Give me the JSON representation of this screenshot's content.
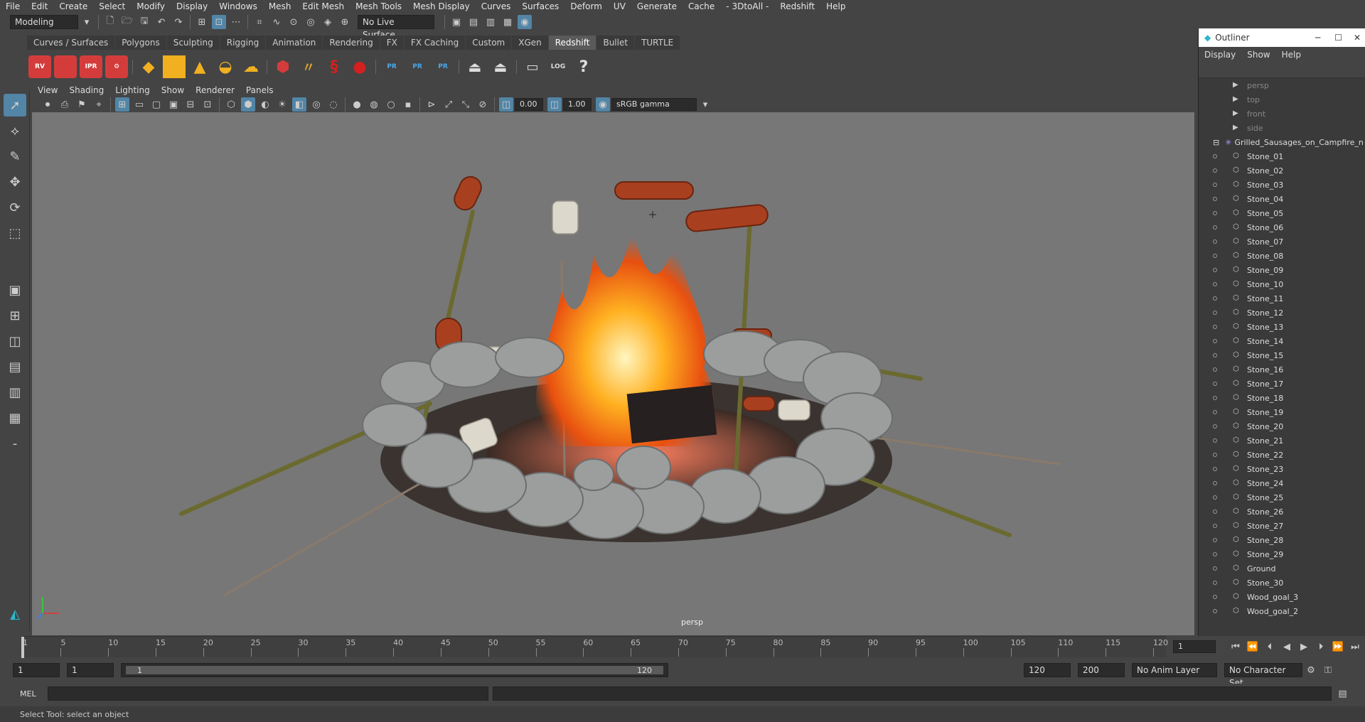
{
  "menubar": {
    "items": [
      "File",
      "Edit",
      "Create",
      "Select",
      "Modify",
      "Display",
      "Windows",
      "Mesh",
      "Edit Mesh",
      "Mesh Tools",
      "Mesh Display",
      "Curves",
      "Surfaces",
      "Deform",
      "UV",
      "Generate",
      "Cache",
      "- 3DtoAll -",
      "Redshift",
      "Help"
    ]
  },
  "statusline": {
    "mode": "Modeling",
    "live_surface": "No Live Surface"
  },
  "shelf": {
    "tabs": [
      "Curves / Surfaces",
      "Polygons",
      "Sculpting",
      "Rigging",
      "Animation",
      "Rendering",
      "FX",
      "FX Caching",
      "Custom",
      "XGen",
      "Redshift",
      "Bullet",
      "TURTLE"
    ],
    "active": "Redshift",
    "icon_labels": [
      "RV",
      "",
      "IPR",
      "",
      "PR",
      "PR",
      "PR",
      "LOG"
    ]
  },
  "panel": {
    "menu": [
      "View",
      "Shading",
      "Lighting",
      "Show",
      "Renderer",
      "Panels"
    ],
    "exposure": "0.00",
    "gamma": "1.00",
    "colorspace": "sRGB gamma",
    "camera_label": "persp"
  },
  "outliner": {
    "title": "Outliner",
    "menu": [
      "Display",
      "Show",
      "Help"
    ],
    "cameras": [
      "persp",
      "top",
      "front",
      "side"
    ],
    "group": "Grilled_Sausages_on_Campfire_n",
    "children": [
      "Stone_01",
      "Stone_02",
      "Stone_03",
      "Stone_04",
      "Stone_05",
      "Stone_06",
      "Stone_07",
      "Stone_08",
      "Stone_09",
      "Stone_10",
      "Stone_11",
      "Stone_12",
      "Stone_13",
      "Stone_14",
      "Stone_15",
      "Stone_16",
      "Stone_17",
      "Stone_18",
      "Stone_19",
      "Stone_20",
      "Stone_21",
      "Stone_22",
      "Stone_23",
      "Stone_24",
      "Stone_25",
      "Stone_26",
      "Stone_27",
      "Stone_28",
      "Stone_29",
      "Ground",
      "Stone_30",
      "Wood_goal_3",
      "Wood_goal_2"
    ]
  },
  "timeline": {
    "ticks": [
      "1",
      "5",
      "10",
      "15",
      "20",
      "25",
      "30",
      "35",
      "40",
      "45",
      "50",
      "55",
      "60",
      "65",
      "70",
      "75",
      "80",
      "85",
      "90",
      "95",
      "100",
      "105",
      "110",
      "115",
      "120"
    ],
    "current_frame": "1"
  },
  "range": {
    "start": "1",
    "playback_start": "1",
    "slider_start": "1",
    "slider_end": "120",
    "playback_end": "120",
    "end": "200",
    "anim_layer": "No Anim Layer",
    "char_set": "No Character Set"
  },
  "cmdline": {
    "label": "MEL"
  },
  "helpline": {
    "text": "Select Tool: select an object"
  }
}
